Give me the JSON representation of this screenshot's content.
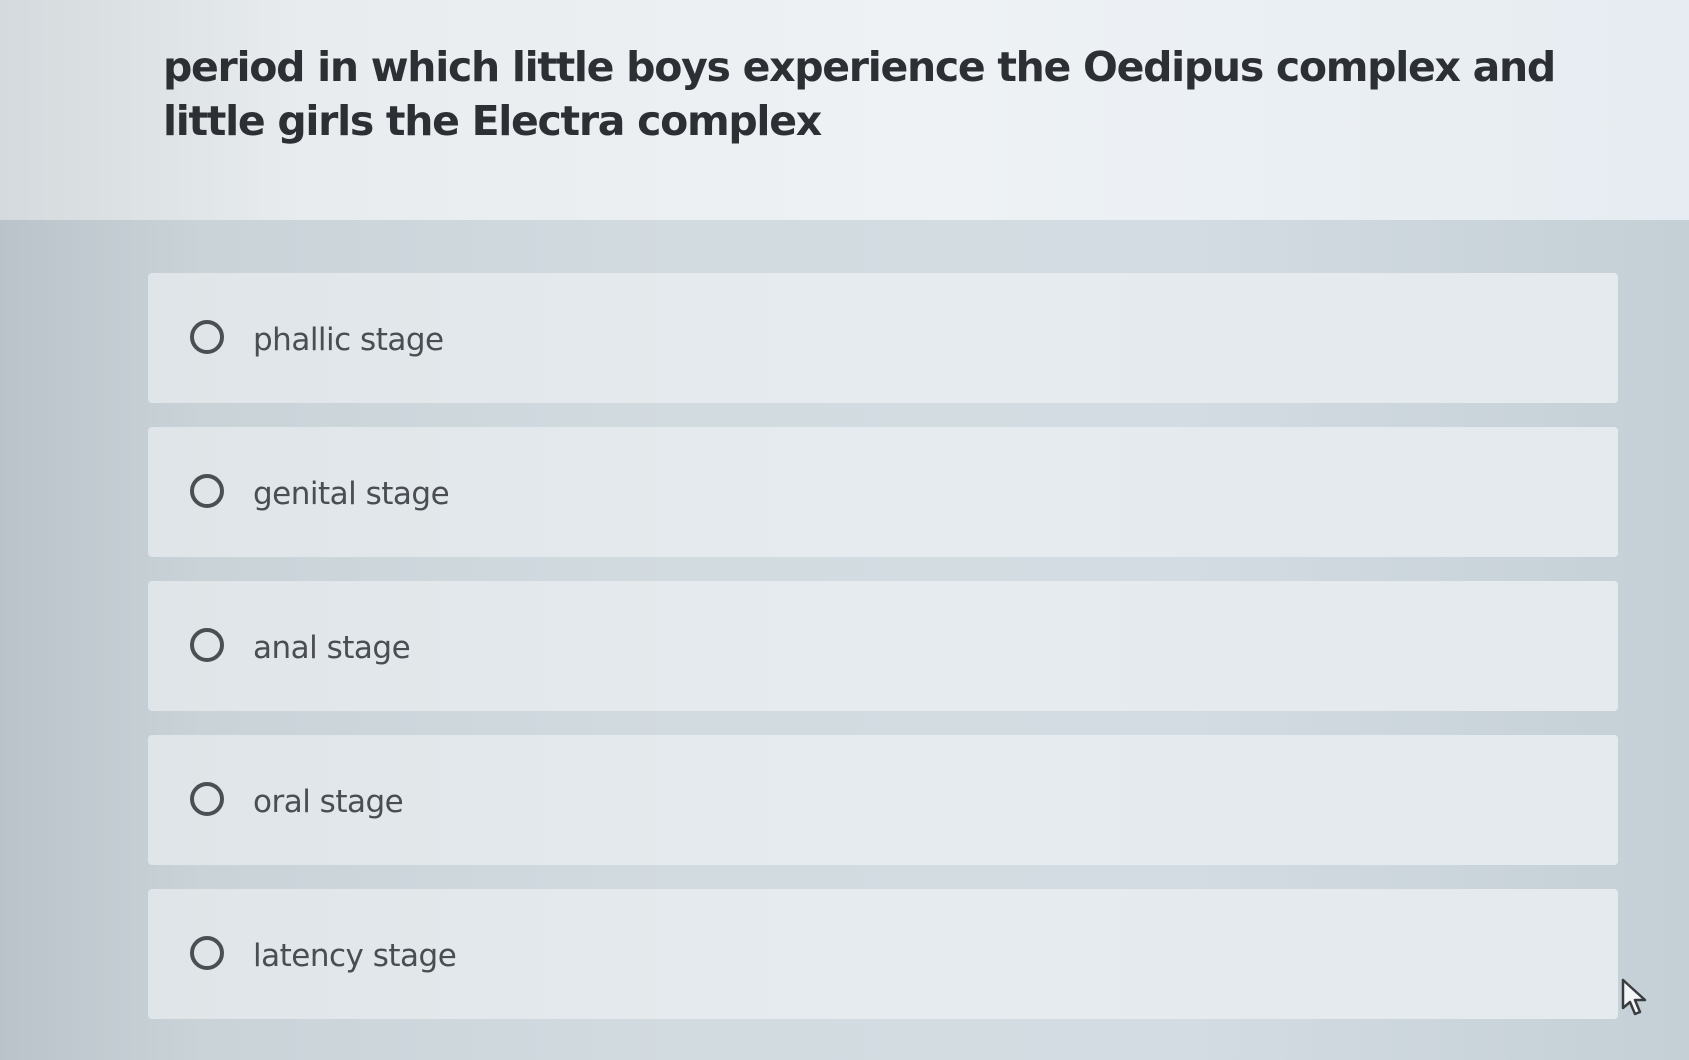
{
  "question": {
    "text": "period in which little boys experience the Oedipus complex and little girls the Electra complex"
  },
  "options": [
    {
      "label": "phallic stage",
      "selected": false
    },
    {
      "label": "genital stage",
      "selected": false
    },
    {
      "label": "anal stage",
      "selected": false
    },
    {
      "label": "oral stage",
      "selected": false
    },
    {
      "label": "latency stage",
      "selected": false
    }
  ],
  "icons": {
    "radio": "radio-unchecked-icon",
    "cursor": "mouse-pointer-icon"
  },
  "colors": {
    "question_text": "#2c2f33",
    "option_text": "#4a4d52",
    "radio_border": "#4b4f54"
  }
}
